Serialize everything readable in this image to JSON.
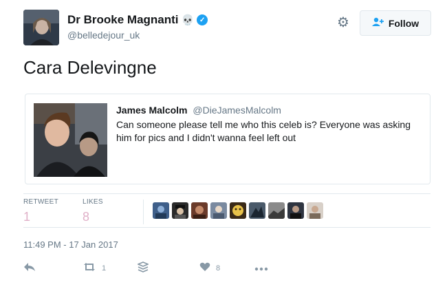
{
  "author": {
    "name": "Dr Brooke Magnanti",
    "name_emoji": "💀",
    "verified_icon": "verified-badge-icon",
    "handle": "@belledejour_uk"
  },
  "header": {
    "settings_icon": "gear-icon",
    "follow_label": "Follow",
    "follow_icon": "add-user-icon"
  },
  "tweet": {
    "text": "Cara Delevingne"
  },
  "quoted_tweet": {
    "author_name": "James Malcolm",
    "author_handle": "@DieJamesMalcolm",
    "text": "Can someone please tell me who this celeb is? Everyone was asking him for pics and I didn't wanna feel left out"
  },
  "stats": {
    "retweets_label": "RETWEET",
    "retweets_value": "1",
    "likes_label": "LIKES",
    "likes_value": "8"
  },
  "timestamp": "11:49 PM - 17 Jan 2017",
  "actions": {
    "retweet_count": "1",
    "like_count": "8"
  },
  "colors": {
    "accent": "#1da1f2",
    "muted": "#657786",
    "stat_value": "#e0b0c8",
    "border": "#e1e8ed"
  }
}
